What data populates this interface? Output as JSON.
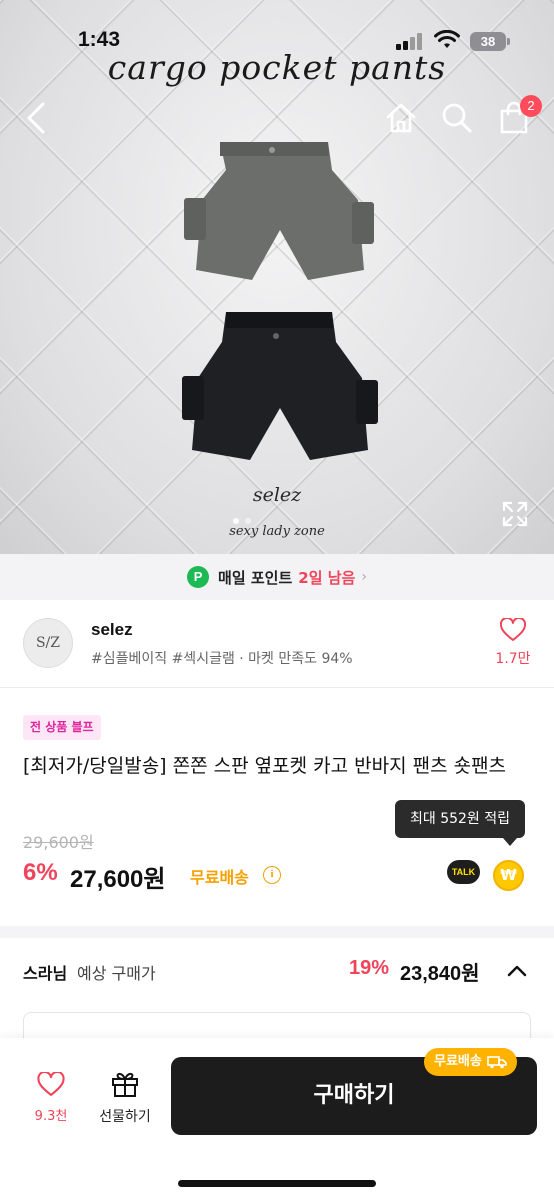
{
  "status_bar": {
    "time": "1:43",
    "battery": "38"
  },
  "hero": {
    "title": "cargo pocket pants",
    "brand_script": "selez",
    "brand_sub": "sexy lady zone",
    "cart_badge": "2"
  },
  "point_banner": {
    "label": "매일 포인트",
    "highlight": "2일 남음",
    "icon_letter": "P"
  },
  "shop": {
    "name": "selez",
    "avatar_text": "S/Z",
    "tags": "#심플베이직 #섹시글램 · 마켓 만족도 94%",
    "like_count": "1.7만"
  },
  "product": {
    "sale_badge": "전 상품 블프",
    "title": "[최저가/당일발송] 쫀쫀 스판 옆포켓 카고 반바지 팬츠 숏팬츠",
    "tooltip": "최대 552원 적립",
    "original_price": "29,600원",
    "discount": "6%",
    "price": "27,600원",
    "free_shipping": "무료배송",
    "talk_label": "TALK",
    "won_symbol": "₩"
  },
  "expected": {
    "user": "스라님",
    "label": "예상 구매가",
    "discount": "19%",
    "price": "23,840원"
  },
  "bottom_bar": {
    "wish_count": "9.3천",
    "gift_label": "선물하기",
    "buy_label": "구매하기",
    "ship_pill": "무료배송"
  },
  "colors": {
    "accent": "#f0445a",
    "shipping": "#f5a100",
    "buy_button": "#1c1c1c",
    "point": "#1db954"
  }
}
